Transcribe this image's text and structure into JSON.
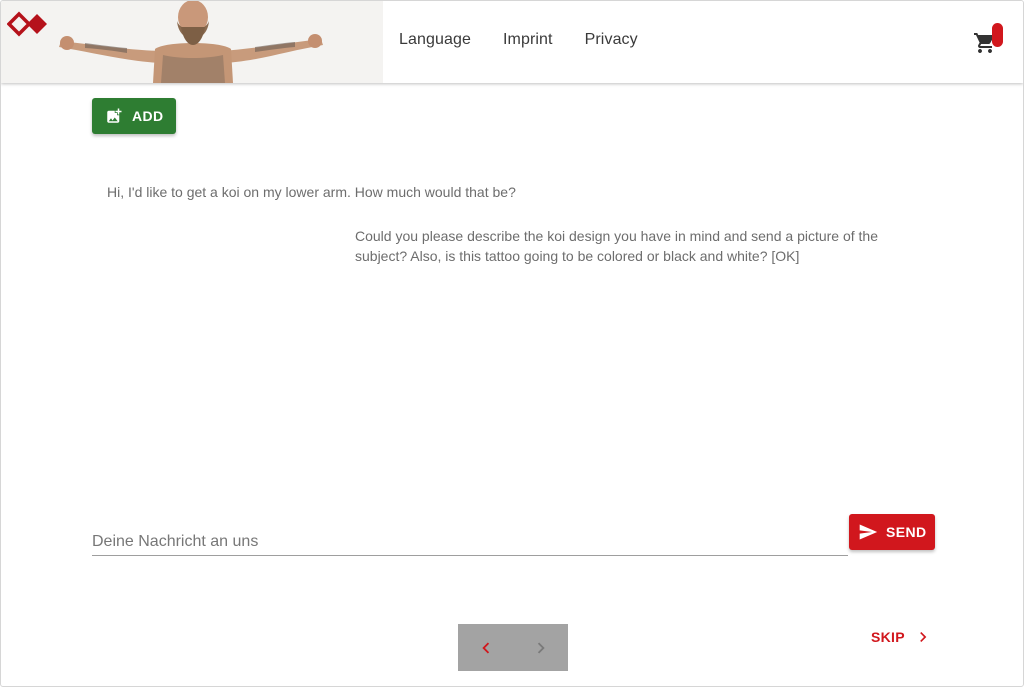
{
  "header": {
    "nav": [
      {
        "label": "Language"
      },
      {
        "label": "Imprint"
      },
      {
        "label": "Privacy"
      }
    ]
  },
  "toolbar": {
    "add_label": "ADD"
  },
  "chat": {
    "messages": [
      {
        "from": "user",
        "text": "Hi, I'd like to get a koi on my lower arm. How much would that be?"
      },
      {
        "from": "studio",
        "text": "Could you please describe the koi design you have in mind and send a picture of the subject? Also, is this tattoo going to be colored or black and white? [OK]"
      }
    ]
  },
  "composer": {
    "placeholder": "Deine Nachricht an uns",
    "value": "",
    "send_label": "SEND"
  },
  "footer": {
    "skip_label": "SKIP"
  },
  "colors": {
    "accent": "#d1171d",
    "add_button": "#2e7d32",
    "pager_bg": "#a3a3a3"
  },
  "icons": {
    "logo": "diamond-logo",
    "cart": "shopping-cart-icon",
    "add": "add-photo-icon",
    "send": "send-icon",
    "prev": "chevron-left-icon",
    "next": "chevron-right-icon",
    "skip": "chevron-right-icon"
  }
}
